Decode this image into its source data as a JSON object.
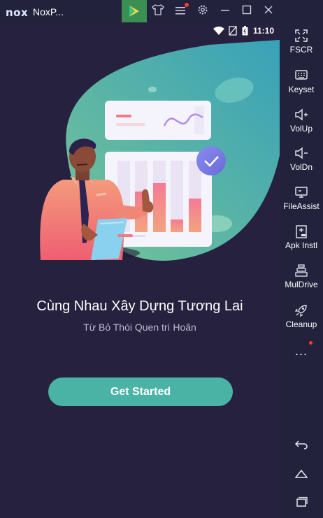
{
  "titlebar": {
    "logo": "nox",
    "app_title": "NoxP...",
    "icons": [
      "play-store-icon",
      "shirt-icon",
      "menu-icon",
      "settings-icon",
      "minimize-icon",
      "maximize-icon",
      "close-icon",
      "collapse-icon"
    ]
  },
  "statusbar": {
    "time": "11:10"
  },
  "onboarding": {
    "heading": "Cùng Nhau Xây Dựng Tương Lai",
    "subheading": "Từ Bỏ Thói Quen trì Hoãn",
    "button_label": "Get Started"
  },
  "sidebar": {
    "items": [
      {
        "label": "FSCR",
        "icon": "fullscreen-icon"
      },
      {
        "label": "Keyset",
        "icon": "keyboard-icon"
      },
      {
        "label": "VolUp",
        "icon": "volume-up-icon"
      },
      {
        "label": "VolDn",
        "icon": "volume-down-icon"
      },
      {
        "label": "FileAssist",
        "icon": "file-assist-icon"
      },
      {
        "label": "Apk Instl",
        "icon": "apk-install-icon"
      },
      {
        "label": "MulDrive",
        "icon": "multi-drive-icon"
      },
      {
        "label": "Cleanup",
        "icon": "rocket-icon"
      }
    ],
    "more": "..."
  },
  "colors": {
    "accent": "#4bb3a5",
    "phone_bg": "#26213f",
    "chrome_bg": "#22223c",
    "notification": "#ff3b30"
  }
}
